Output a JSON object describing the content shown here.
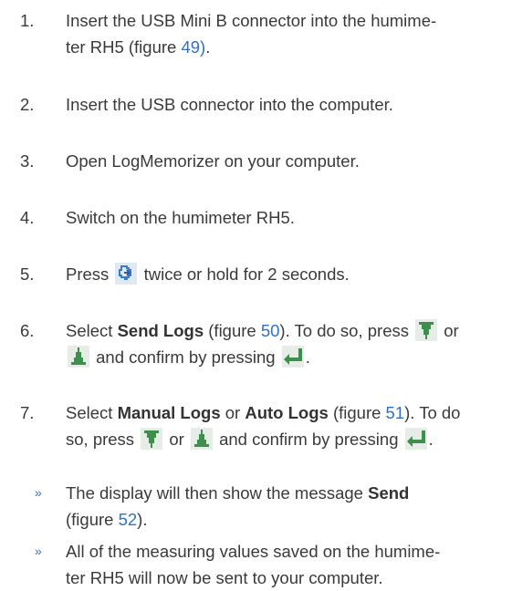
{
  "steps": [
    {
      "num": "1.",
      "line1": "Insert the USB Mini B connector into the humime-",
      "line2_pre": "ter RH5 (figure ",
      "fig": "49)",
      "line2_post": "."
    },
    {
      "num": "2.",
      "text": "Insert the USB connector into the computer."
    },
    {
      "num": "3.",
      "text": "Open LogMemorizer on your computer."
    },
    {
      "num": "4.",
      "text": "Switch on the humimeter RH5."
    },
    {
      "num": "5.",
      "pre": "Press ",
      "post": " twice or hold for 2 seconds.",
      "icon": "enter-arrow-icon"
    },
    {
      "num": "6.",
      "a": "Select ",
      "bold": "Send Logs",
      "b": " (figure ",
      "fig": "50",
      "c": "). To do so, press ",
      "d": " or",
      "e": " and confirm by pressing ",
      "f": "."
    },
    {
      "num": "7.",
      "a": "Select ",
      "bold1": "Manual Logs",
      "b": " or ",
      "bold2": "Auto Logs",
      "c": " (figure ",
      "fig": "51",
      "d": "). To do",
      "e": "so, press ",
      "f": " or ",
      "g": " and confirm by pressing ",
      "h": "."
    }
  ],
  "notes": [
    {
      "bullet": "»",
      "line1_pre": "The display will then show the message ",
      "line1_bold": "Send",
      "line2_pre": "(figure ",
      "fig": "52",
      "line2_post": ")."
    },
    {
      "bullet": "»",
      "line1": "All of the measuring values saved on the humime-",
      "line2": "ter RH5 will now be sent to your computer."
    }
  ],
  "colors": {
    "text": "#3a3a3a",
    "link": "#2f72c4",
    "icon_blue": "#3a7cc7",
    "icon_green": "#3f8f4c"
  }
}
